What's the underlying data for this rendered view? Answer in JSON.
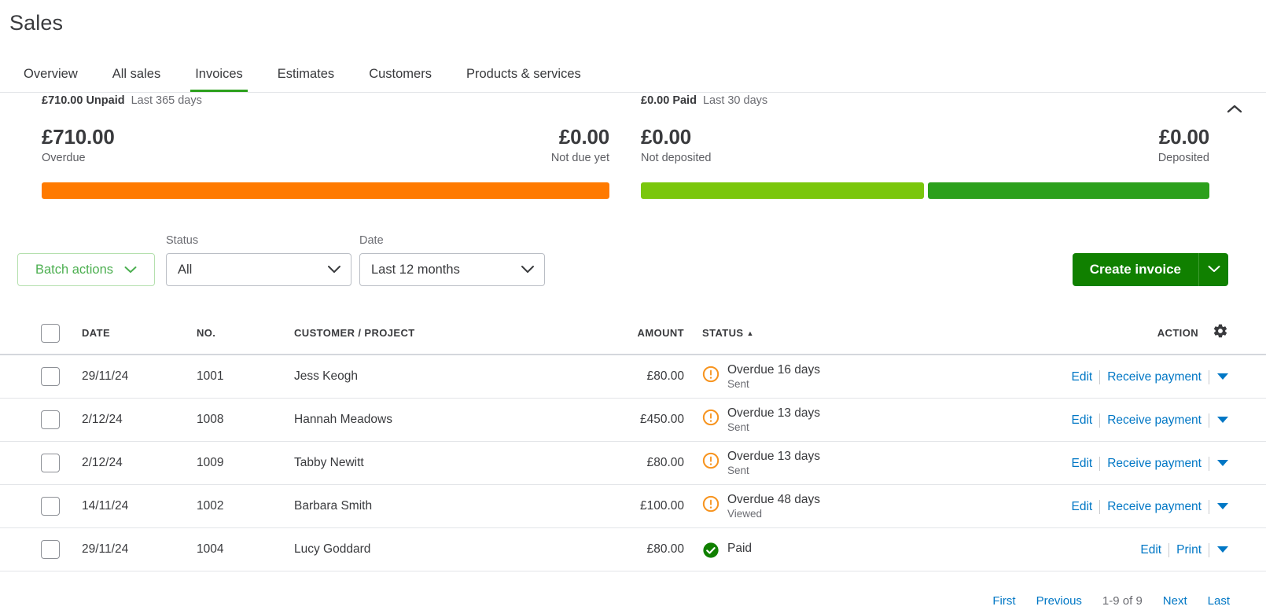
{
  "header": {
    "title": "Sales"
  },
  "tabs": [
    {
      "label": "Overview",
      "active": false
    },
    {
      "label": "All sales",
      "active": false
    },
    {
      "label": "Invoices",
      "active": true
    },
    {
      "label": "Estimates",
      "active": false
    },
    {
      "label": "Customers",
      "active": false
    },
    {
      "label": "Products & services",
      "active": false
    }
  ],
  "summary": {
    "collapse_icon": "chevron-up-icon",
    "unpaid": {
      "caption_amount": "£710.00 Unpaid",
      "caption_period": "Last 365 days",
      "left": {
        "value": "£710.00",
        "label": "Overdue"
      },
      "right": {
        "value": "£0.00",
        "label": "Not due yet"
      },
      "bar_color": "#ff7a00"
    },
    "paid": {
      "caption_amount": "£0.00 Paid",
      "caption_period": "Last 30 days",
      "left": {
        "value": "£0.00",
        "label": "Not deposited"
      },
      "right": {
        "value": "£0.00",
        "label": "Deposited"
      },
      "bar_color_not_deposited": "#7ac70c",
      "bar_color_deposited": "#2ca01c"
    }
  },
  "filters": {
    "batch_actions_label": "Batch actions",
    "status_label": "Status",
    "status_value": "All",
    "date_label": "Date",
    "date_value": "Last 12 months",
    "create_label": "Create invoice",
    "accent_green": "#108000",
    "batch_green": "#4caf50"
  },
  "table": {
    "columns": {
      "date": "DATE",
      "no": "NO.",
      "customer": "CUSTOMER / PROJECT",
      "amount": "AMOUNT",
      "status": "STATUS",
      "action": "ACTION"
    },
    "sort": {
      "column": "STATUS",
      "direction": "▲"
    },
    "settings_icon": "gear-icon",
    "rows": [
      {
        "date": "29/11/24",
        "no": "1001",
        "customer": "Jess Keogh",
        "amount": "£80.00",
        "status_icon": "warning-icon",
        "status_main": "Overdue 16 days",
        "status_sub": "Sent",
        "action_primary": "Edit",
        "action_secondary": "Receive payment"
      },
      {
        "date": "2/12/24",
        "no": "1008",
        "customer": "Hannah Meadows",
        "amount": "£450.00",
        "status_icon": "warning-icon",
        "status_main": "Overdue 13 days",
        "status_sub": "Sent",
        "action_primary": "Edit",
        "action_secondary": "Receive payment"
      },
      {
        "date": "2/12/24",
        "no": "1009",
        "customer": "Tabby Newitt",
        "amount": "£80.00",
        "status_icon": "warning-icon",
        "status_main": "Overdue 13 days",
        "status_sub": "Sent",
        "action_primary": "Edit",
        "action_secondary": "Receive payment"
      },
      {
        "date": "14/11/24",
        "no": "1002",
        "customer": "Barbara Smith",
        "amount": "£100.00",
        "status_icon": "warning-icon",
        "status_main": "Overdue 48 days",
        "status_sub": "Viewed",
        "action_primary": "Edit",
        "action_secondary": "Receive payment"
      },
      {
        "date": "29/11/24",
        "no": "1004",
        "customer": "Lucy Goddard",
        "amount": "£80.00",
        "status_icon": "check-circle-icon",
        "status_main": "Paid",
        "status_sub": "",
        "action_primary": "Edit",
        "action_secondary": "Print"
      }
    ]
  },
  "pagination": {
    "first": "First",
    "previous": "Previous",
    "range": "1-9 of 9",
    "next": "Next",
    "last": "Last"
  }
}
